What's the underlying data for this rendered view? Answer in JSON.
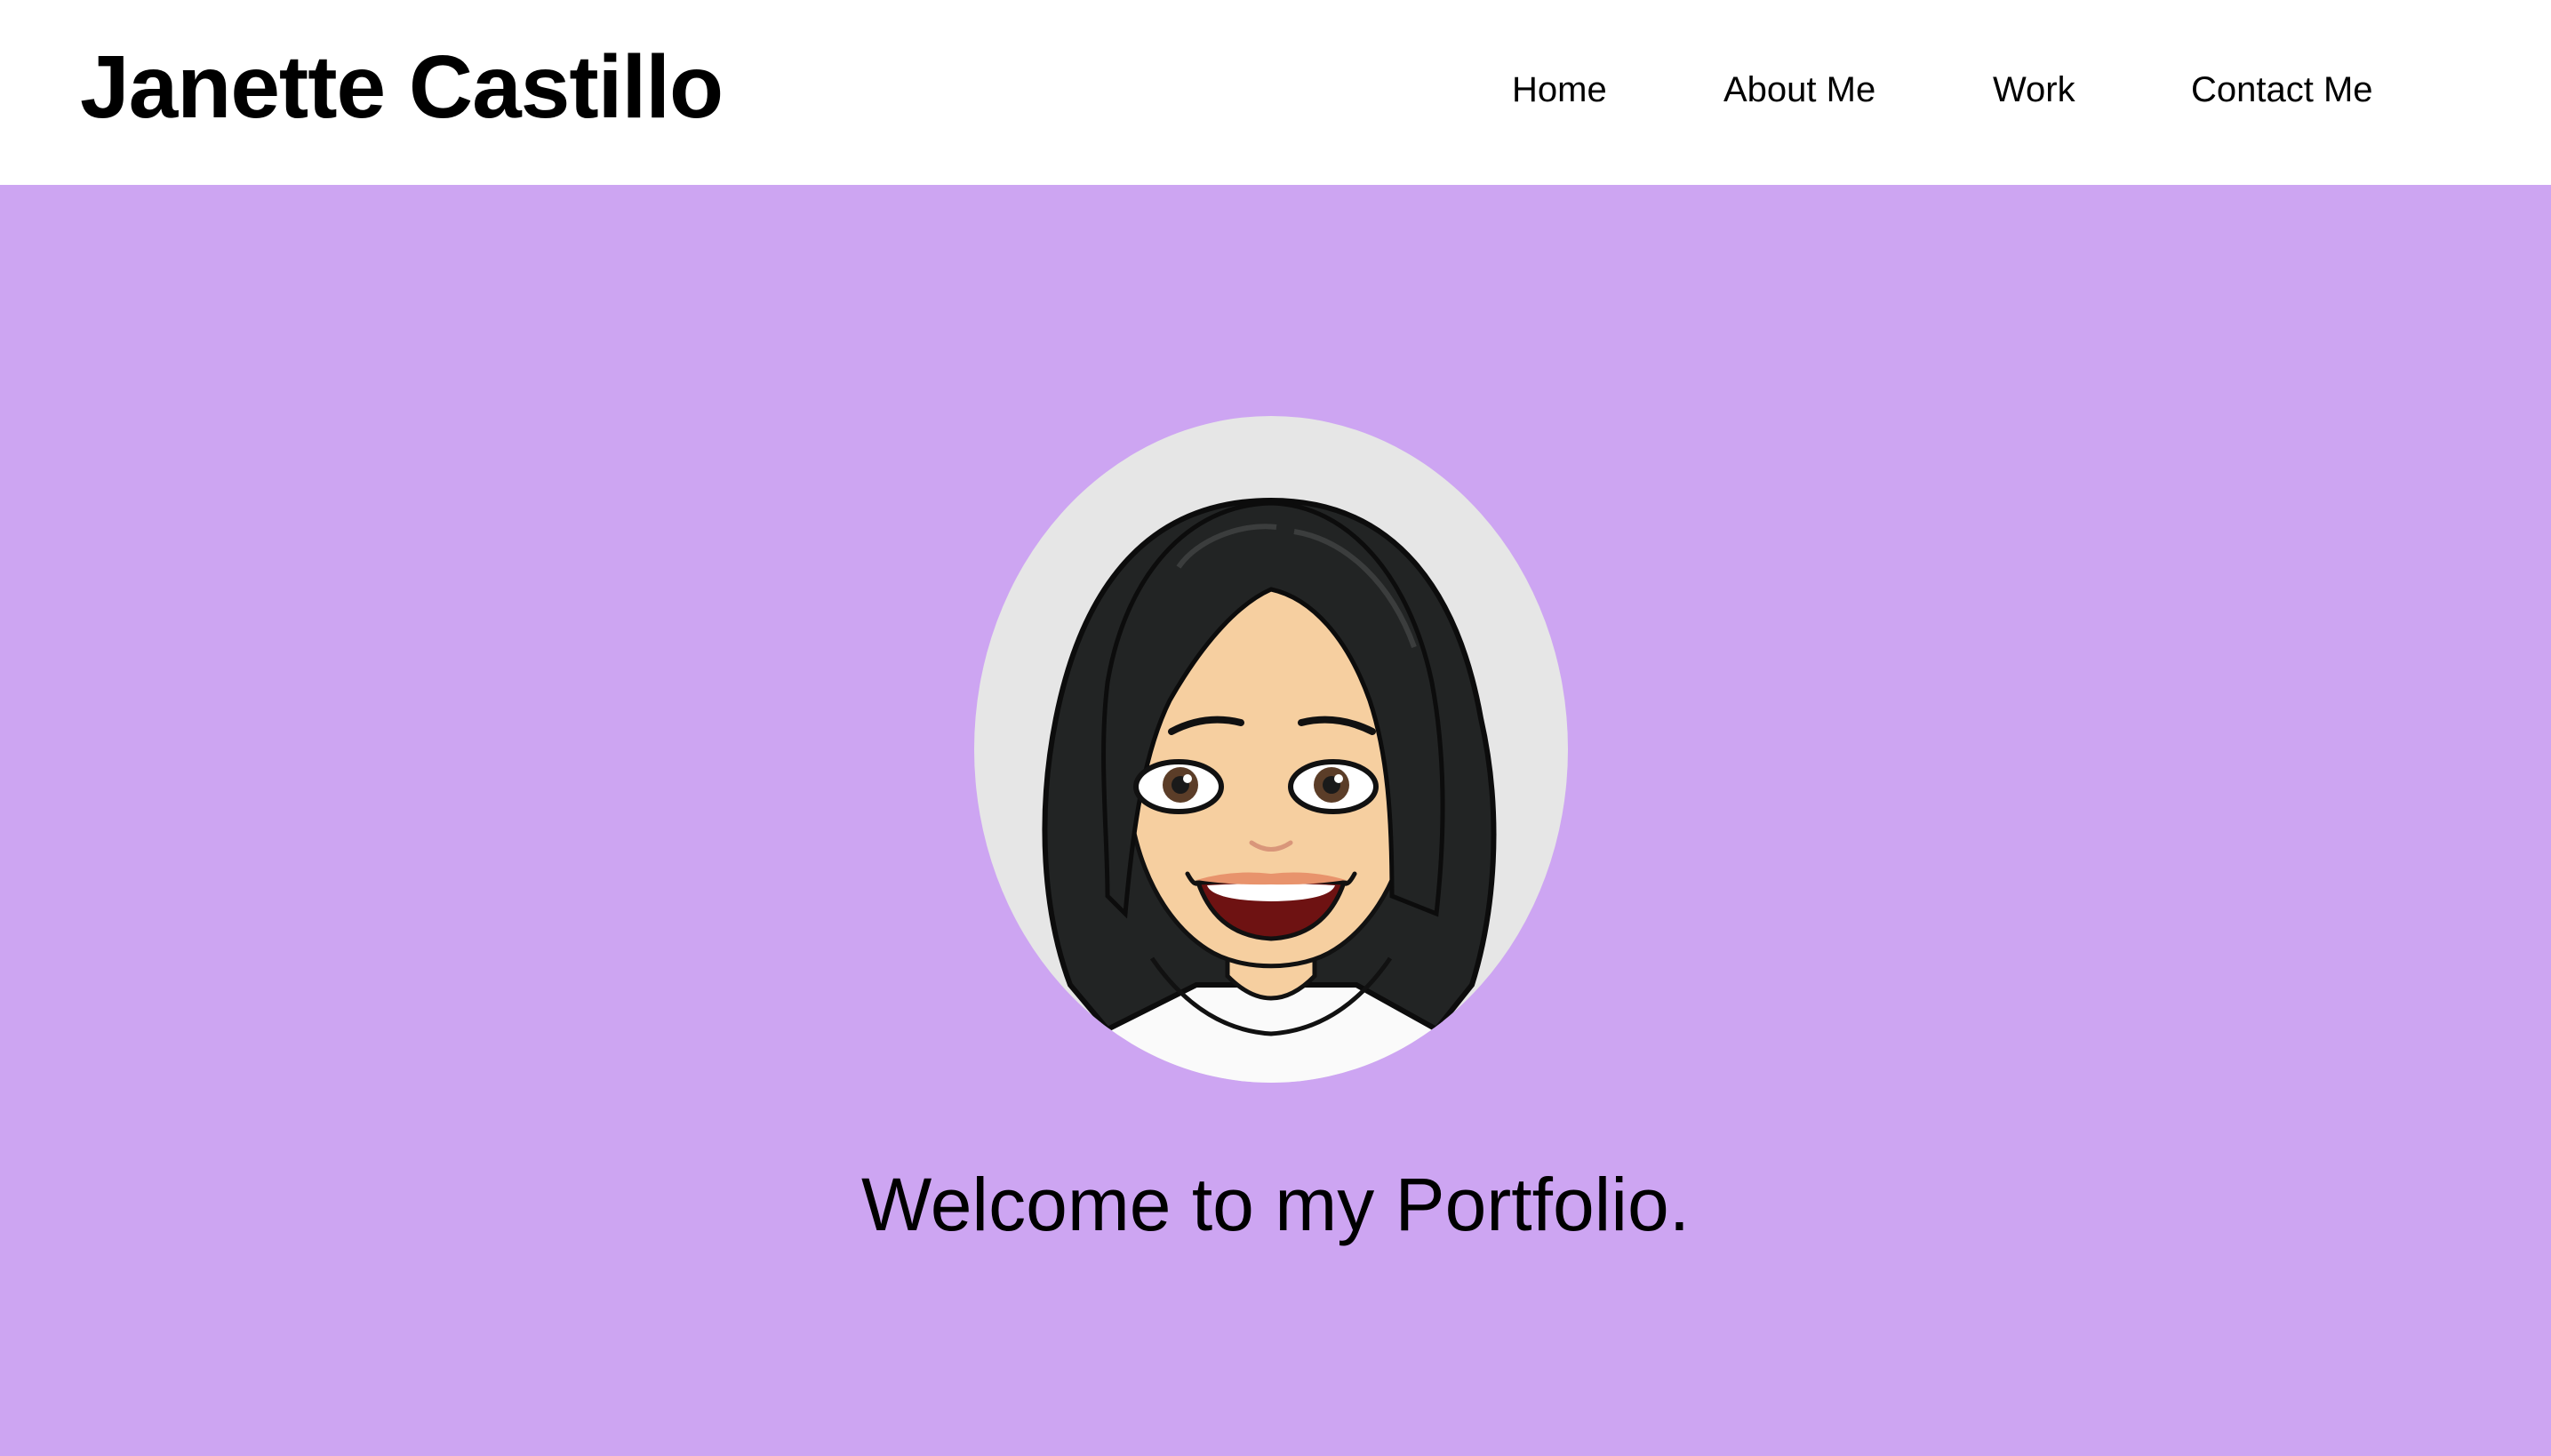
{
  "header": {
    "site_title": "Janette Castillo",
    "nav": {
      "home": "Home",
      "about": "About Me",
      "work": "Work",
      "contact": "Contact Me"
    }
  },
  "hero": {
    "welcome_text": "Welcome to my Portfolio."
  },
  "colors": {
    "hero_background": "#cda5f2",
    "header_background": "#ffffff",
    "avatar_circle": "#e6e6e6",
    "hair": "#222424",
    "skin": "#f6cfa0",
    "text": "#000000"
  },
  "icons": {
    "avatar": "cartoon-avatar-portrait"
  }
}
